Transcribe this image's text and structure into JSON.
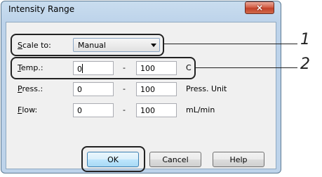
{
  "window": {
    "title": "Intensity Range",
    "close_icon": "×"
  },
  "scale": {
    "label": "Scale to:",
    "value": "Manual"
  },
  "rows": [
    {
      "label": "Temp.:",
      "from": "0",
      "to": "100",
      "unit": "C"
    },
    {
      "label": "Press.:",
      "from": "0",
      "to": "100",
      "unit": "Press. Unit"
    },
    {
      "label": "Flow:",
      "from": "0",
      "to": "100",
      "unit": "mL/min"
    }
  ],
  "separator": "-",
  "buttons": {
    "ok": "OK",
    "cancel": "Cancel",
    "help": "Help"
  },
  "callouts": {
    "one": "1",
    "two": "2"
  }
}
